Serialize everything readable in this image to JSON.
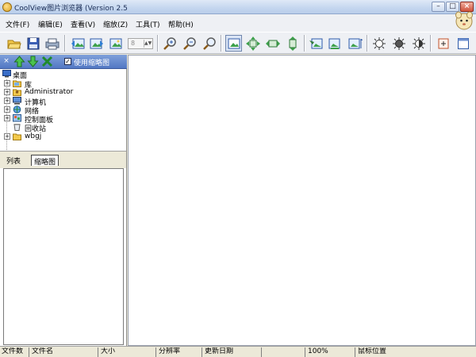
{
  "window": {
    "title": "CoolView图片浏览器 (Version 2.5",
    "minimize_label": "–",
    "maximize_label": "□",
    "close_label": "×"
  },
  "menu": {
    "items": [
      {
        "label": "文件(F)"
      },
      {
        "label": "编辑(E)"
      },
      {
        "label": "查看(V)"
      },
      {
        "label": "缩放(Z)"
      },
      {
        "label": "工具(T)"
      },
      {
        "label": "帮助(H)"
      }
    ]
  },
  "toolbar": {
    "page_value": "8",
    "spin_label": "▲▼"
  },
  "panel": {
    "close_label": "×",
    "checkbox_checked": "✓",
    "checkbox_label": "使用缩略图"
  },
  "tree": {
    "items": [
      {
        "label": "桌面",
        "icon": "desktop-icon"
      },
      {
        "label": "库",
        "icon": "library-icon"
      },
      {
        "label": "Administrator",
        "icon": "user-folder-icon"
      },
      {
        "label": "计算机",
        "icon": "computer-icon"
      },
      {
        "label": "网络",
        "icon": "network-icon"
      },
      {
        "label": "控制面板",
        "icon": "control-panel-icon"
      },
      {
        "label": "回收站",
        "icon": "recycle-bin-icon"
      },
      {
        "label": "wbgj",
        "icon": "folder-icon"
      }
    ]
  },
  "tabs": [
    {
      "label": "列表"
    },
    {
      "label": "缩略图"
    }
  ],
  "status": {
    "cells": [
      {
        "label": "文件数"
      },
      {
        "label": "文件名"
      },
      {
        "label": "大小"
      },
      {
        "label": "分辨率"
      },
      {
        "label": "更新日期"
      },
      {
        "label": ""
      },
      {
        "label": "100%"
      },
      {
        "label": "鼠标位置"
      }
    ]
  }
}
